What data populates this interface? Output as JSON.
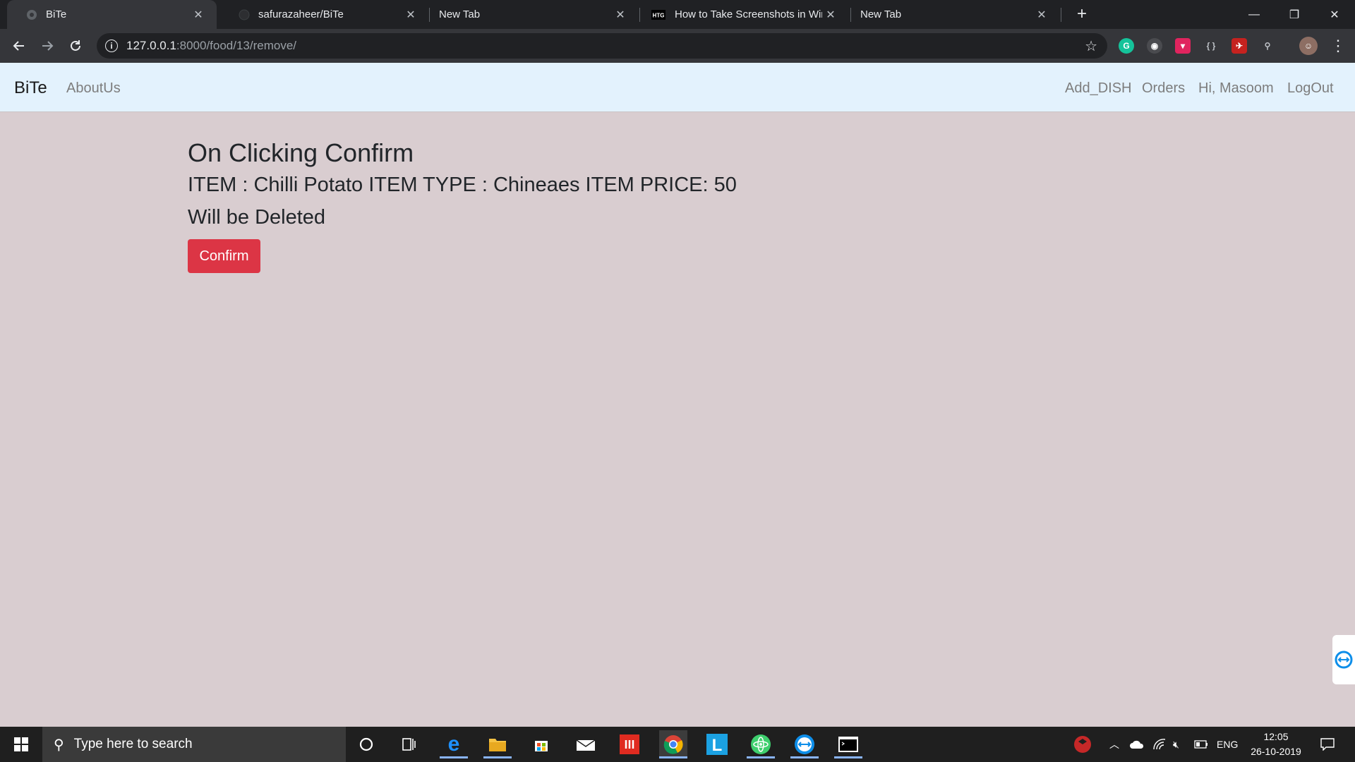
{
  "browser": {
    "tabs": [
      {
        "title": "BiTe",
        "active": true,
        "icon": "globe-icon"
      },
      {
        "title": "safurazaheer/BiTe",
        "active": false,
        "icon": "github-icon"
      },
      {
        "title": "New Tab",
        "active": false,
        "icon": ""
      },
      {
        "title": "How to Take Screenshots in Windc",
        "active": false,
        "icon": "htg-icon"
      },
      {
        "title": "New Tab",
        "active": false,
        "icon": ""
      }
    ],
    "tab_close_glyph": "✕",
    "new_tab_glyph": "+",
    "url_host": "127.0.0.1",
    "url_path": ":8000/food/13/remove/",
    "window_controls": {
      "minimize": "—",
      "restore": "❐",
      "close": "✕"
    }
  },
  "site": {
    "brand": "BiTe",
    "nav_left": [
      "AboutUs"
    ],
    "nav_right": [
      "Add_DISH",
      "Orders",
      "Hi, Masoom",
      "LogOut"
    ]
  },
  "content": {
    "heading": "On Clicking Confirm",
    "item_line": "ITEM : Chilli Potato ITEM TYPE : Chineaes ITEM PRICE: 50",
    "deleted_line": "Will be Deleted",
    "confirm_label": "Confirm"
  },
  "taskbar": {
    "search_placeholder": "Type here to search",
    "language": "ENG",
    "time": "12:05",
    "date": "26-10-2019"
  },
  "colors": {
    "page_bg": "#d9cdd0",
    "navbar_bg": "#e3f2fd",
    "confirm_bg": "#dc3545"
  }
}
